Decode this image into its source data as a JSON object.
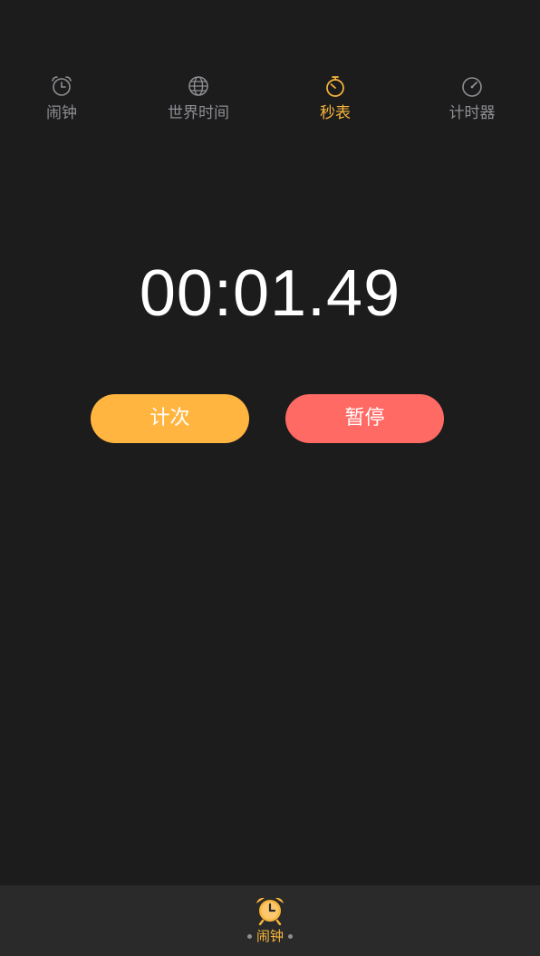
{
  "tabs": [
    {
      "label": "闹钟",
      "icon": "alarm-clock-icon",
      "active": false
    },
    {
      "label": "世界时间",
      "icon": "globe-icon",
      "active": false
    },
    {
      "label": "秒表",
      "icon": "stopwatch-icon",
      "active": true
    },
    {
      "label": "计时器",
      "icon": "timer-icon",
      "active": false
    }
  ],
  "stopwatch": {
    "display": "00:01.49"
  },
  "buttons": {
    "lap_label": "计次",
    "pause_label": "暂停"
  },
  "bottom_nav": {
    "label": "闹钟",
    "icon": "alarm-clock-icon"
  },
  "colors": {
    "background": "#1c1c1d",
    "accent": "#f8b53c",
    "lap_button": "#ffb53f",
    "pause_button": "#ff6a64",
    "inactive_text": "#8e8e93",
    "bottom_bar": "#2a2a2b"
  }
}
